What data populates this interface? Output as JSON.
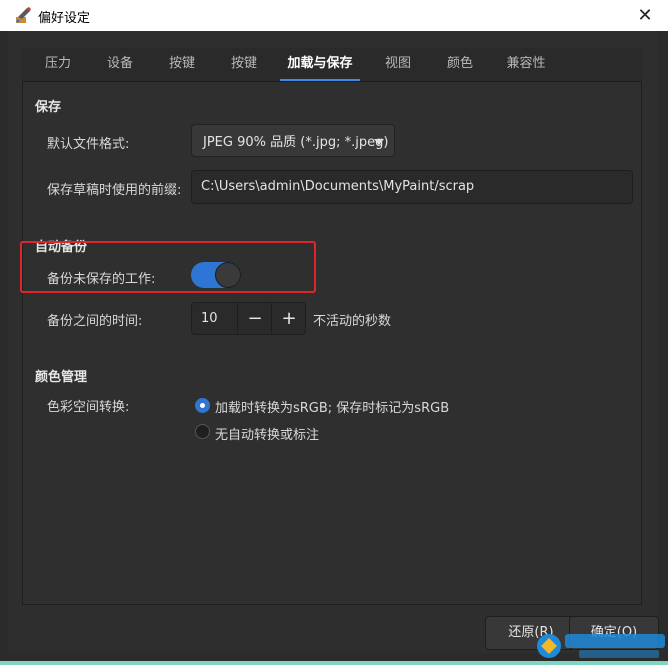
{
  "window": {
    "title": "偏好设定"
  },
  "tabs": [
    {
      "label": "压力"
    },
    {
      "label": "设备"
    },
    {
      "label": "按键"
    },
    {
      "label": "按键"
    },
    {
      "label": "加载与保存"
    },
    {
      "label": "视图"
    },
    {
      "label": "颜色"
    },
    {
      "label": "兼容性"
    }
  ],
  "active_tab": "加载与保存",
  "save": {
    "title": "保存",
    "format_label": "默认文件格式:",
    "format_value": "JPEG 90% 品质 (*.jpg; *.jpeg)",
    "prefix_label": "保存草稿时使用的前缀:",
    "prefix_value": "C:\\Users\\admin\\Documents\\MyPaint/scrap"
  },
  "autosave": {
    "title": "自动备份",
    "backup_label": "备份未保存的工作:",
    "backup_enabled": true,
    "interval_label": "备份之间的时间:",
    "interval_value": "10",
    "minus": "−",
    "plus": "+",
    "interval_suffix": "不活动的秒数"
  },
  "color_management": {
    "title": "颜色管理",
    "conversion_label": "色彩空间转换:",
    "options": [
      {
        "label": "加载时转换为sRGB; 保存时标记为sRGB",
        "selected": true
      },
      {
        "label": "无自动转换或标注",
        "selected": false
      }
    ]
  },
  "buttons": {
    "revert": "还原(R)",
    "ok": "确定(O)"
  },
  "colors": {
    "accent": "#2f76d4",
    "highlight": "#e0262b",
    "background": "#2b2b2b"
  },
  "icons": {
    "app": "mypaint-app-icon",
    "close": "close-icon",
    "dropdown": "chevron-down-icon"
  }
}
